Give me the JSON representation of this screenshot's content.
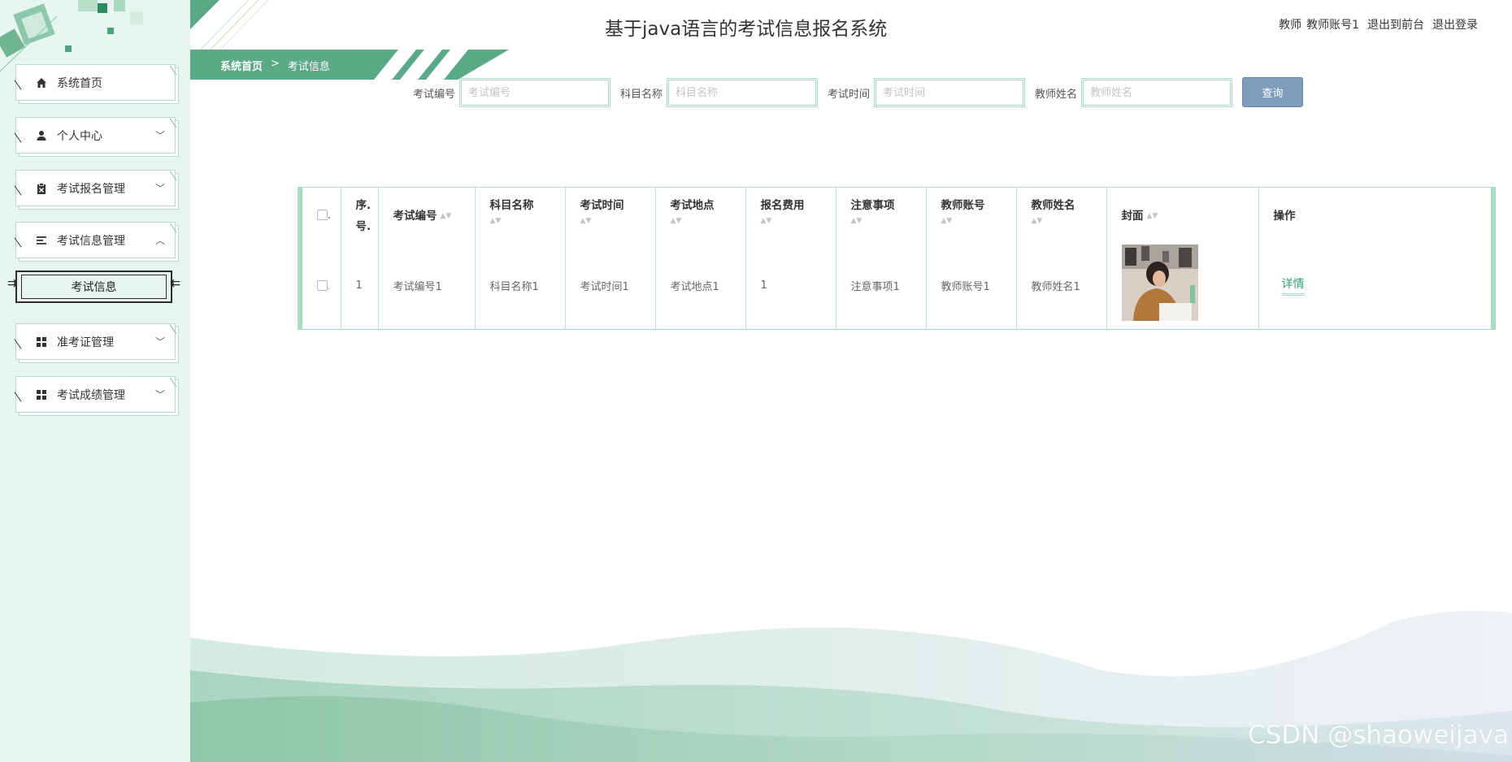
{
  "app": {
    "title": "基于java语言的考试信息报名系统"
  },
  "user_bar": {
    "role": "教师",
    "account": "教师账号1",
    "to_front": "退出到前台",
    "logout": "退出登录"
  },
  "breadcrumb": {
    "home": "系统首页",
    "separator": ">",
    "current": "考试信息"
  },
  "sidebar": {
    "items": [
      {
        "label": "系统首页",
        "icon": "home-icon"
      },
      {
        "label": "个人中心",
        "icon": "user-icon",
        "arrow": "chevron-down-icon"
      },
      {
        "label": "考试报名管理",
        "icon": "clipboard-icon",
        "arrow": "chevron-down-icon"
      },
      {
        "label": "考试信息管理",
        "icon": "list-icon",
        "arrow": "chevron-up-icon",
        "expanded": true
      },
      {
        "label": "准考证管理",
        "icon": "grid-icon",
        "arrow": "chevron-down-icon"
      },
      {
        "label": "考试成绩管理",
        "icon": "grid-icon",
        "arrow": "chevron-down-icon"
      }
    ],
    "sub_item": {
      "label": "考试信息"
    }
  },
  "search": {
    "fields": [
      {
        "label": "考试编号",
        "placeholder": "考试编号",
        "value": ""
      },
      {
        "label": "科目名称",
        "placeholder": "科目名称",
        "value": ""
      },
      {
        "label": "考试时间",
        "placeholder": "考试时间",
        "value": ""
      },
      {
        "label": "教师姓名",
        "placeholder": "教师姓名",
        "value": ""
      }
    ],
    "button_label": "查询"
  },
  "table": {
    "index_header_top": "序.",
    "index_header_bottom": "号.",
    "checkbox_suffix": ".",
    "columns": [
      "考试编号",
      "科目名称",
      "考试时间",
      "考试地点",
      "报名费用",
      "注意事项",
      "教师账号",
      "教师姓名",
      "封面",
      "操作"
    ],
    "sort_glyph": "▲▼",
    "rows": [
      {
        "index": "1",
        "exam_no": "考试编号1",
        "subject": "科目名称1",
        "exam_time": "考试时间1",
        "location": "考试地点1",
        "fee": "1",
        "notes": "注意事项1",
        "teacher_account": "教师账号1",
        "teacher_name": "教师姓名1",
        "action": "详情"
      }
    ]
  },
  "watermark": "CSDN @shaoweijava",
  "colors": {
    "sidebar_bg": "#e6f5ee",
    "accent_green": "#5aa987",
    "border_green": "#a8ddc4",
    "search_button": "#7f9cbd",
    "detail_link": "#2f9e6f"
  }
}
